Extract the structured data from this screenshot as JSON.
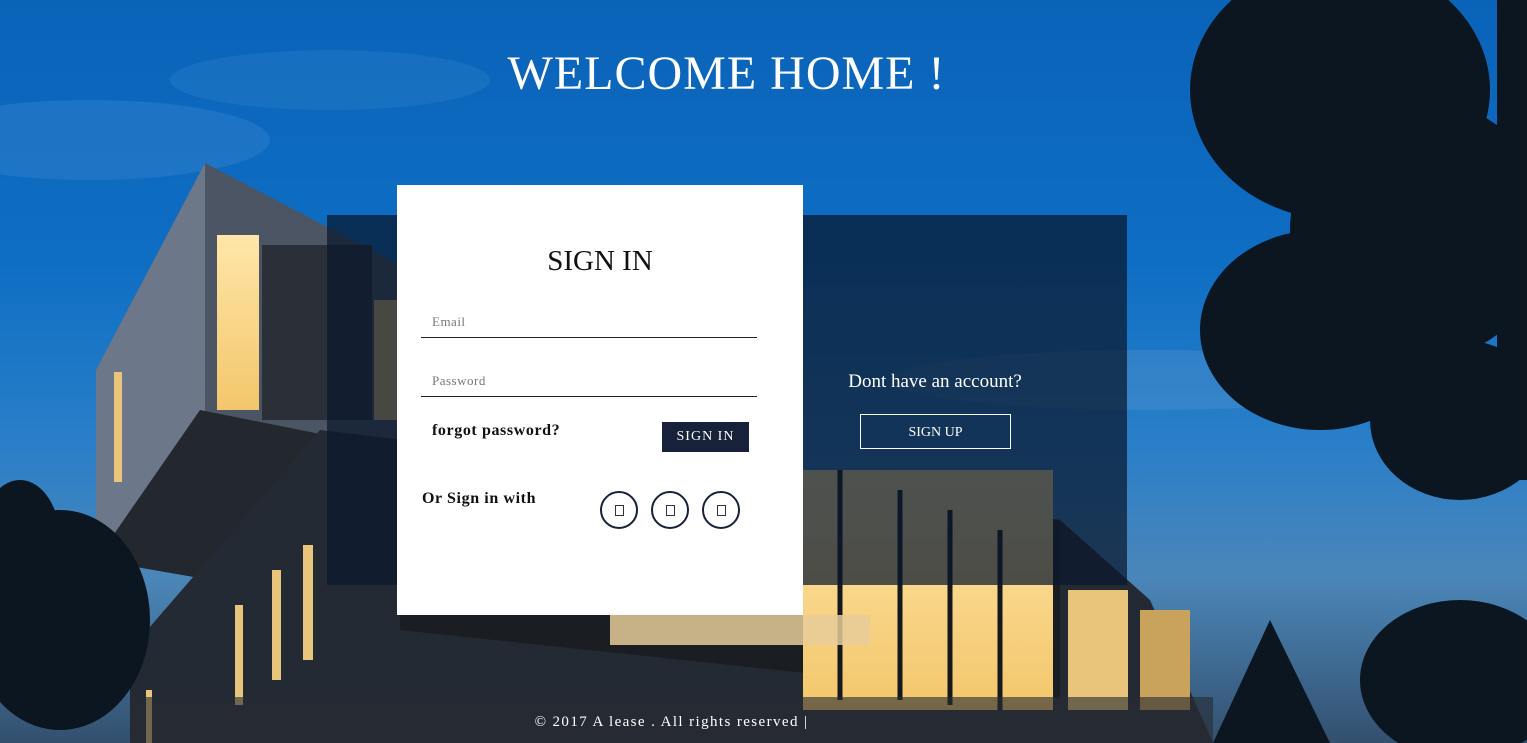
{
  "page": {
    "welcome": "WELCOME HOME !"
  },
  "signin": {
    "title": "SIGN IN",
    "email_placeholder": "Email",
    "password_placeholder": "Password",
    "forgot_label": "forgot password?",
    "button_label": "SIGN IN",
    "or_label": "Or Sign in with",
    "social_icons": [
      "social-icon-1",
      "social-icon-2",
      "social-icon-3"
    ]
  },
  "signup": {
    "question": "Dont have an account?",
    "button_label": "SIGN UP"
  },
  "footer": {
    "text": "© 2017 A lease . All rights reserved |"
  },
  "colors": {
    "card_bg": "#ffffff",
    "primary_button": "#17213a",
    "panel": "#0a182c"
  }
}
